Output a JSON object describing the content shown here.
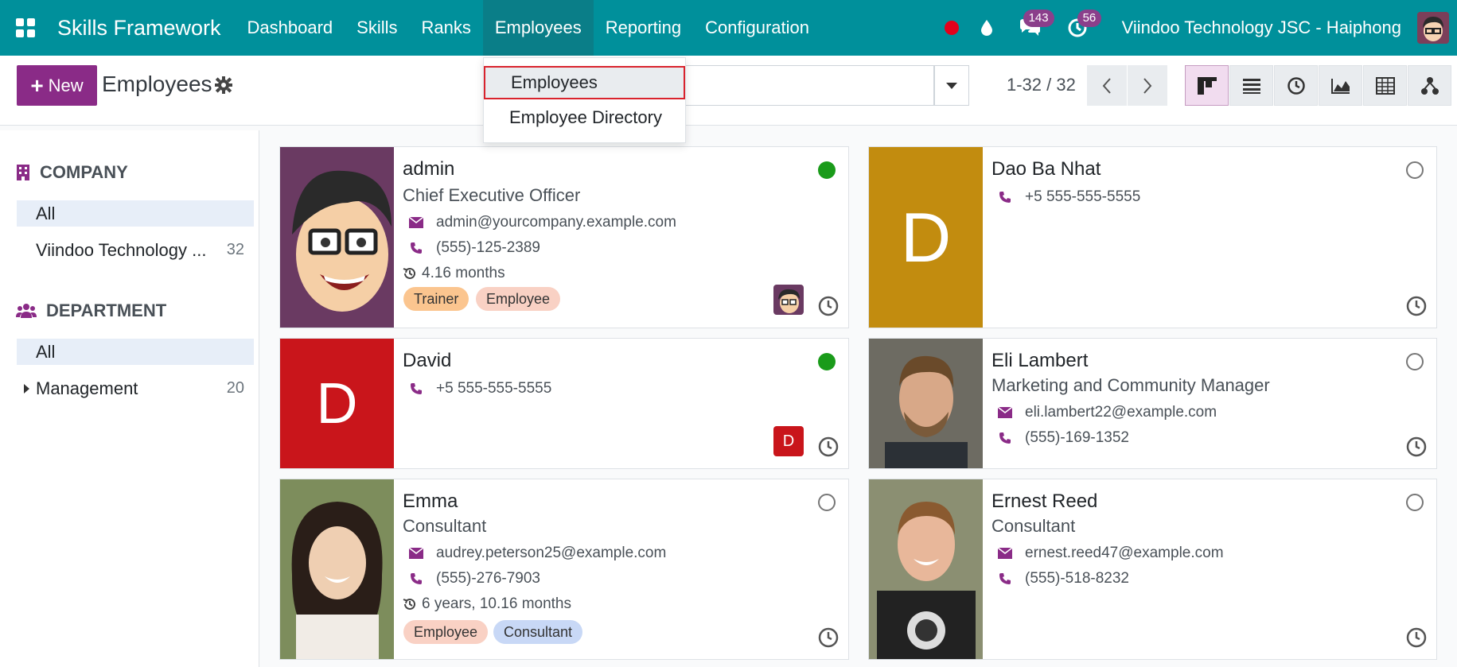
{
  "navbar": {
    "brand": "Skills Framework",
    "menu": [
      "Dashboard",
      "Skills",
      "Ranks",
      "Employees",
      "Reporting",
      "Configuration"
    ],
    "active_menu": "Employees",
    "messages_badge": "143",
    "activity_badge": "56",
    "company": "Viindoo Technology JSC - Haiphong"
  },
  "control": {
    "new_label": "New",
    "title": "Employees",
    "pager": "1-32 / 32"
  },
  "dropdown": {
    "items": [
      "Employees",
      "Employee Directory"
    ]
  },
  "sidebar": {
    "company_header": "COMPANY",
    "company_items": [
      {
        "label": "All",
        "count": ""
      },
      {
        "label": "Viindoo Technology ...",
        "count": "32"
      }
    ],
    "department_header": "DEPARTMENT",
    "department_items": [
      {
        "label": "All",
        "count": ""
      },
      {
        "label": "Management",
        "count": "20"
      }
    ]
  },
  "cards": [
    {
      "name": "admin",
      "job": "Chief Executive Officer",
      "email": "admin@yourcompany.example.com",
      "phone": "(555)-125-2389",
      "seniority": "4.16 months",
      "tags": [
        "Trainer",
        "Employee"
      ],
      "status": "online"
    },
    {
      "name": "Dao Ba Nhat",
      "phone": "+5 555-555-5555",
      "letter": "D",
      "status": "offline"
    },
    {
      "name": "David",
      "phone": "+5 555-555-5555",
      "letter": "D",
      "mini_letter": "D",
      "status": "online"
    },
    {
      "name": "Eli Lambert",
      "job": "Marketing and Community Manager",
      "email": "eli.lambert22@example.com",
      "phone": "(555)-169-1352",
      "status": "offline"
    },
    {
      "name": "Emma",
      "job": "Consultant",
      "email": "audrey.peterson25@example.com",
      "phone": "(555)-276-7903",
      "seniority": "6 years, 10.16 months",
      "tags": [
        "Employee",
        "Consultant"
      ],
      "status": "offline"
    },
    {
      "name": "Ernest Reed",
      "job": "Consultant",
      "email": "ernest.reed47@example.com",
      "phone": "(555)-518-8232",
      "status": "offline"
    }
  ],
  "colors": {
    "navbar": "#00909b",
    "primary": "#8a2b87",
    "online": "#1a9b1a",
    "dao_avatar": "#c28c0f",
    "david_avatar": "#c9151b",
    "tag_trainer": "#fbc58f",
    "tag_employee": "#f9d1c4",
    "tag_consultant": "#c8d8f6"
  }
}
